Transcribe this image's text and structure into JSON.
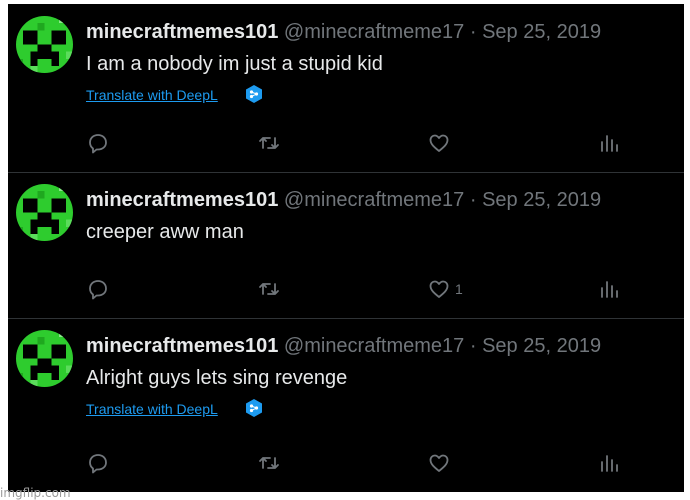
{
  "colors": {
    "background": "#000000",
    "text": "#e7e9ea",
    "muted": "#71767b",
    "link": "#1d9bf0",
    "avatar_green": "#2ecc2e"
  },
  "tweets": [
    {
      "display_name": "minecraftmemes101",
      "handle": "@minecraftmeme17",
      "separator": "·",
      "date": "Sep 25, 2019",
      "text": "I am a nobody im just a stupid kid",
      "translate_label": "Translate with DeepL",
      "like_count": ""
    },
    {
      "display_name": "minecraftmemes101",
      "handle": "@minecraftmeme17",
      "separator": "·",
      "date": "Sep 25, 2019",
      "text": "creeper aww man",
      "translate_label": "",
      "like_count": "1"
    },
    {
      "display_name": "minecraftmemes101",
      "handle": "@minecraftmeme17",
      "separator": "·",
      "date": "Sep 25, 2019",
      "text": "Alright guys lets sing revenge",
      "translate_label": "Translate with DeepL",
      "like_count": ""
    }
  ],
  "icons": {
    "reply": "reply-icon",
    "retweet": "retweet-icon",
    "like": "heart-icon",
    "views": "views-icon",
    "deepl": "deepl-icon"
  },
  "watermark": "imgflip.com"
}
